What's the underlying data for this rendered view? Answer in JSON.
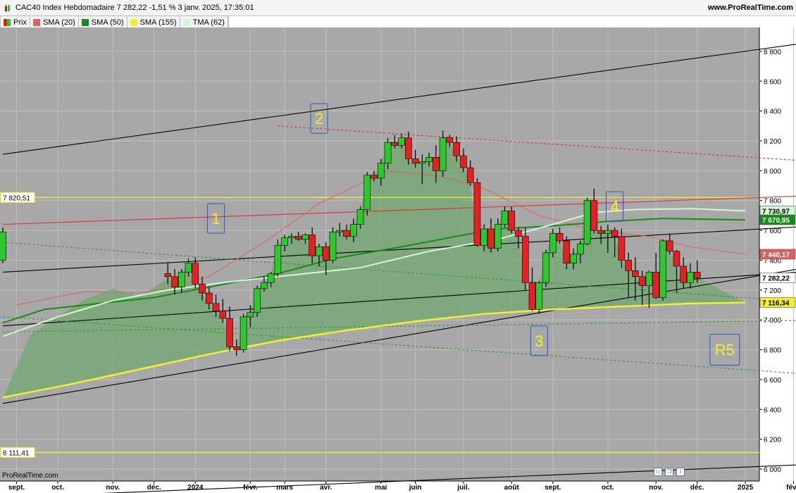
{
  "header": {
    "title": "CAC40 Index Hebdomadaire 7 282,22 -1,51 % 3 janv. 2025, 17:35:01",
    "site": "www.ProRealTime.com"
  },
  "legend": [
    {
      "label": "Prix",
      "color": "#2e9e2e"
    },
    {
      "label": "SMA (20)",
      "color": "#e06060"
    },
    {
      "label": "SMA (50)",
      "color": "#1a8a1a"
    },
    {
      "label": "SMA (155)",
      "color": "#f2ee30"
    },
    {
      "label": "TMA (62)",
      "color": "#d6f5d6"
    }
  ],
  "footer": {
    "watermark": "ProRealTime.com"
  },
  "colors": {
    "plot_background": "#a8a8a8",
    "up_candle": "#2ec82e",
    "down_candle": "#e62020",
    "area_fill": "#72a872",
    "sma20": "#e06060",
    "sma50": "#1a8a1a",
    "sma155": "#f2ee30",
    "tma62": "#d6f5d6",
    "annotation_text": "#f2ee30",
    "annotation_border": "#2a55c8"
  },
  "icons": [
    "window-icon",
    "copy-icon",
    "info-icon"
  ],
  "chart_data": {
    "type": "candlestick",
    "y_ticks": [
      "8 800",
      "8 600",
      "8 400",
      "8 200",
      "8 000",
      "7 800",
      "7 600",
      "7 400",
      "7 200",
      "7 000",
      "6 800",
      "6 600",
      "6 400",
      "6 200",
      "6 000"
    ],
    "ylim": [
      5920,
      8960
    ],
    "x_ticks": [
      "sept.",
      "oct.",
      "nov.",
      "déc.",
      "2024",
      "févr.",
      "mars",
      "avr.",
      "mai",
      "juin",
      "juil.",
      "août",
      "sept.",
      "oct.",
      "nov.",
      "déc.",
      "2025",
      "févr."
    ],
    "price_labels": [
      {
        "text": "7 730,97",
        "value": 7730.97,
        "series": "TMA (62)"
      },
      {
        "text": "7 670,95",
        "value": 7670.95,
        "series": "SMA (50)"
      },
      {
        "text": "7 440,17",
        "value": 7440.17,
        "series": "SMA (20)"
      },
      {
        "text": "7 282,22",
        "value": 7282.22,
        "series": "Prix"
      },
      {
        "text": "7 116,34",
        "value": 7116.34,
        "series": "SMA (155)"
      }
    ],
    "level_labels": [
      {
        "text": "7 820,51",
        "value": 7820.51
      },
      {
        "text": "6 111,41",
        "value": 6111.41
      }
    ],
    "wave_labels": [
      {
        "text": "1",
        "week": 31,
        "value": 7680
      },
      {
        "text": "2",
        "week": 46,
        "value": 8350
      },
      {
        "text": "3",
        "week": 78,
        "value": 6860
      },
      {
        "text": "4",
        "week": 89,
        "value": 7760
      },
      {
        "text": "R5",
        "week": 105,
        "value": 6800
      }
    ],
    "week_labels": [
      {
        "label": "sept.",
        "week": 2
      },
      {
        "label": "oct.",
        "week": 8
      },
      {
        "label": "nov.",
        "week": 16
      },
      {
        "label": "déc.",
        "week": 22
      },
      {
        "label": "2024",
        "week": 28
      },
      {
        "label": "févr.",
        "week": 36
      },
      {
        "label": "mars",
        "week": 41
      },
      {
        "label": "avr.",
        "week": 47
      },
      {
        "label": "mai",
        "week": 55
      },
      {
        "label": "juin",
        "week": 60
      },
      {
        "label": "juil.",
        "week": 67
      },
      {
        "label": "août",
        "week": 74
      },
      {
        "label": "sept.",
        "week": 80
      },
      {
        "label": "oct.",
        "week": 88
      },
      {
        "label": "nov.",
        "week": 95
      },
      {
        "label": "déc.",
        "week": 101
      },
      {
        "label": "2025",
        "week": 108
      },
      {
        "label": "févr.",
        "week": 115
      }
    ],
    "candles": [
      [
        7310,
        7380,
        7240,
        7290
      ],
      [
        7290,
        7340,
        7170,
        7220
      ],
      [
        7220,
        7340,
        7180,
        7320
      ],
      [
        7320,
        7410,
        7290,
        7380
      ],
      [
        7380,
        7420,
        7210,
        7240
      ],
      [
        7240,
        7290,
        7130,
        7180
      ],
      [
        7180,
        7220,
        7070,
        7110
      ],
      [
        7110,
        7170,
        7020,
        7060
      ],
      [
        7060,
        7140,
        6980,
        7010
      ],
      [
        7010,
        7090,
        6790,
        6820
      ],
      [
        6820,
        6870,
        6760,
        6800
      ],
      [
        6800,
        7040,
        6780,
        7020
      ],
      [
        7020,
        7100,
        6950,
        7050
      ],
      [
        7050,
        7230,
        7020,
        7210
      ],
      [
        7210,
        7290,
        7190,
        7250
      ],
      [
        7250,
        7320,
        7220,
        7310
      ],
      [
        7310,
        7540,
        7290,
        7500
      ],
      [
        7500,
        7570,
        7460,
        7550
      ],
      [
        7550,
        7580,
        7510,
        7560
      ],
      [
        7560,
        7590,
        7530,
        7540
      ],
      [
        7540,
        7580,
        7510,
        7570
      ],
      [
        7570,
        7620,
        7380,
        7430
      ],
      [
        7430,
        7510,
        7360,
        7490
      ],
      [
        7490,
        7520,
        7300,
        7400
      ],
      [
        7400,
        7620,
        7380,
        7590
      ],
      [
        7590,
        7650,
        7560,
        7600
      ],
      [
        7600,
        7640,
        7540,
        7560
      ],
      [
        7560,
        7680,
        7520,
        7640
      ],
      [
        7640,
        7760,
        7610,
        7740
      ],
      [
        7740,
        7990,
        7700,
        7970
      ],
      [
        7970,
        8000,
        7930,
        7950
      ],
      [
        7950,
        8080,
        7900,
        8050
      ],
      [
        8050,
        8220,
        8010,
        8190
      ],
      [
        8190,
        8240,
        8150,
        8170
      ],
      [
        8170,
        8250,
        8150,
        8220
      ],
      [
        8220,
        8260,
        8040,
        8080
      ],
      [
        8080,
        8140,
        8020,
        8050
      ],
      [
        8050,
        8110,
        7910,
        8060
      ],
      [
        8060,
        8120,
        8030,
        8090
      ],
      [
        8090,
        8170,
        7920,
        8000
      ],
      [
        8000,
        8270,
        7960,
        8220
      ],
      [
        8220,
        8240,
        8160,
        8190
      ],
      [
        8190,
        8230,
        8060,
        8100
      ],
      [
        8100,
        8150,
        7990,
        8020
      ],
      [
        8020,
        8070,
        7900,
        7920
      ],
      [
        7920,
        7950,
        7490,
        7500
      ],
      [
        7500,
        7640,
        7460,
        7610
      ],
      [
        7610,
        7680,
        7450,
        7480
      ],
      [
        7480,
        7680,
        7460,
        7640
      ],
      [
        7640,
        7760,
        7620,
        7730
      ],
      [
        7730,
        7760,
        7580,
        7600
      ],
      [
        7600,
        7620,
        7480,
        7560
      ],
      [
        7560,
        7620,
        7200,
        7250
      ],
      [
        7250,
        7350,
        7060,
        7070
      ],
      [
        7070,
        7260,
        7040,
        7250
      ],
      [
        7250,
        7470,
        7220,
        7450
      ],
      [
        7450,
        7610,
        7420,
        7580
      ],
      [
        7580,
        7620,
        7510,
        7530
      ],
      [
        7530,
        7560,
        7340,
        7380
      ],
      [
        7380,
        7480,
        7340,
        7440
      ],
      [
        7440,
        7530,
        7380,
        7510
      ],
      [
        7510,
        7820,
        7500,
        7800
      ],
      [
        7800,
        7880,
        7580,
        7600
      ],
      [
        7600,
        7630,
        7510,
        7580
      ],
      [
        7580,
        7640,
        7450,
        7600
      ],
      [
        7600,
        7620,
        7420,
        7560
      ],
      [
        7560,
        7610,
        7350,
        7400
      ],
      [
        7400,
        7450,
        7150,
        7330
      ],
      [
        7330,
        7420,
        7130,
        7290
      ],
      [
        7290,
        7330,
        7100,
        7230
      ],
      [
        7230,
        7330,
        7080,
        7320
      ],
      [
        7320,
        7450,
        7140,
        7150
      ],
      [
        7150,
        7540,
        7130,
        7530
      ],
      [
        7530,
        7580,
        7440,
        7460
      ],
      [
        7460,
        7470,
        7180,
        7360
      ],
      [
        7360,
        7420,
        7210,
        7250
      ],
      [
        7250,
        7380,
        7210,
        7320
      ],
      [
        7320,
        7400,
        7250,
        7282
      ]
    ],
    "candle_week0": 24,
    "series": [
      {
        "name": "SMA (20)",
        "points": [
          [
            2,
            7100
          ],
          [
            12,
            7190
          ],
          [
            20,
            7180
          ],
          [
            26,
            7240
          ],
          [
            30,
            7290
          ],
          [
            38,
            7520
          ],
          [
            46,
            7780
          ],
          [
            56,
            8000
          ],
          [
            64,
            7960
          ],
          [
            70,
            7880
          ],
          [
            78,
            7700
          ],
          [
            86,
            7600
          ],
          [
            94,
            7560
          ],
          [
            100,
            7490
          ],
          [
            108,
            7440
          ]
        ]
      },
      {
        "name": "SMA (50)",
        "points": [
          [
            0,
            6980
          ],
          [
            6,
            7070
          ],
          [
            14,
            7110
          ],
          [
            22,
            7150
          ],
          [
            30,
            7220
          ],
          [
            40,
            7310
          ],
          [
            48,
            7410
          ],
          [
            58,
            7490
          ],
          [
            66,
            7560
          ],
          [
            72,
            7610
          ],
          [
            80,
            7630
          ],
          [
            88,
            7660
          ],
          [
            96,
            7680
          ],
          [
            102,
            7675
          ],
          [
            108,
            7670
          ]
        ]
      },
      {
        "name": "SMA (155)",
        "points": [
          [
            0,
            6480
          ],
          [
            10,
            6570
          ],
          [
            20,
            6670
          ],
          [
            30,
            6770
          ],
          [
            40,
            6860
          ],
          [
            50,
            6930
          ],
          [
            60,
            6990
          ],
          [
            70,
            7040
          ],
          [
            80,
            7070
          ],
          [
            90,
            7090
          ],
          [
            100,
            7110
          ],
          [
            108,
            7116
          ]
        ]
      },
      {
        "name": "TMA (62)",
        "points": [
          [
            0,
            6890
          ],
          [
            8,
            7020
          ],
          [
            16,
            7130
          ],
          [
            24,
            7200
          ],
          [
            32,
            7250
          ],
          [
            42,
            7300
          ],
          [
            52,
            7350
          ],
          [
            62,
            7460
          ],
          [
            72,
            7540
          ],
          [
            80,
            7640
          ],
          [
            86,
            7720
          ],
          [
            92,
            7740
          ],
          [
            100,
            7745
          ],
          [
            108,
            7731
          ]
        ]
      }
    ],
    "trendlines": [
      {
        "from": [
          0,
          7640
        ],
        "to": [
          122,
          7840
        ],
        "color": "#e03030",
        "dash": false
      },
      {
        "from": [
          0,
          8110
        ],
        "to": [
          122,
          8890
        ],
        "color": "#000000",
        "dash": false
      },
      {
        "from": [
          0,
          7320
        ],
        "to": [
          122,
          7640
        ],
        "color": "#000000",
        "dash": false
      },
      {
        "from": [
          0,
          6960
        ],
        "to": [
          122,
          7340
        ],
        "color": "#000000",
        "dash": false
      },
      {
        "from": [
          0,
          6440
        ],
        "to": [
          122,
          7390
        ],
        "color": "#000000",
        "dash": false
      },
      {
        "from": [
          0,
          5810
        ],
        "to": [
          122,
          6040
        ],
        "color": "#000000",
        "dash": false
      },
      {
        "from": [
          40,
          8300
        ],
        "to": [
          122,
          8050
        ],
        "color": "#e03030",
        "dash": true
      },
      {
        "from": [
          0,
          7520
        ],
        "to": [
          122,
          7100
        ],
        "color": "#2c9e2c",
        "dash": true
      },
      {
        "from": [
          0,
          6920
        ],
        "to": [
          122,
          7000
        ],
        "color": "#2c9e2c",
        "dash": true
      },
      {
        "from": [
          0,
          7020
        ],
        "to": [
          122,
          6620
        ],
        "color": "#2c9e2c",
        "dash": true
      }
    ],
    "horizontal_levels": [
      7820.51,
      6111.41
    ]
  }
}
